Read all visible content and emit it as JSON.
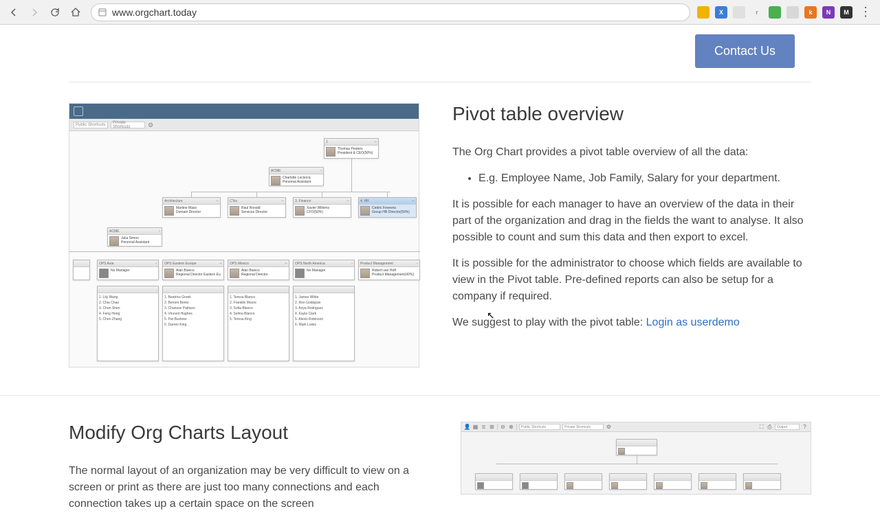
{
  "browser": {
    "url": "www.orgchart.today",
    "extensions": [
      {
        "bg": "#f2b200",
        "txt": ""
      },
      {
        "bg": "#3b7dd8",
        "txt": "X"
      },
      {
        "bg": "#d0d0d0",
        "txt": ""
      },
      {
        "bg": "#d0d0d0",
        "txt": "r"
      },
      {
        "bg": "#4ab050",
        "txt": ""
      },
      {
        "bg": "#d0d0d0",
        "txt": ""
      },
      {
        "bg": "#e87722",
        "txt": "k"
      },
      {
        "bg": "#7d3ab8",
        "txt": "N"
      },
      {
        "bg": "#333333",
        "txt": "M"
      }
    ]
  },
  "header": {
    "contact_label": "Contact Us"
  },
  "section1": {
    "title": "Pivot table overview",
    "p1": "The Org Chart provides a pivot table overview of all the data:",
    "bullet1": "E.g. Employee Name, Job Family, Salary for your department.",
    "p2": "It is possible for each manager to have an overview of the data in their part of the organization and drag in the fields the want to analyse.   It also possible to count and sum this data and then export to excel.",
    "p3": "It is possible for the administrator to choose which fields are available to view in the Pivot table.  Pre-defined reports can also be setup for a company if required.",
    "p4_prefix": "We suggest to play with the pivot table: ",
    "link_text": "Login as userdemo"
  },
  "section2": {
    "title": "Modify Org Charts Layout",
    "p1": "The normal layout of an organization may be very difficult to view on a screen or print as there are just too many connections and each connection takes up a certain space on the screen"
  },
  "mock": {
    "dd1": "Public Shortcuts",
    "dd2": "Private Shortcuts",
    "ceo": {
      "hdr": "1",
      "name": "Thomas Peeters",
      "role": "President & CEO(50%)"
    },
    "assist1": {
      "hdr": "ACME",
      "name": "Charlotte Leclercq",
      "role": "Personal Assistant"
    },
    "row2": [
      {
        "hdr": "Architecture",
        "name": "Martine Mass",
        "role": "Domain Director"
      },
      {
        "hdr": "CTec",
        "name": "Raul Ronald",
        "role": "Services Director"
      },
      {
        "hdr": "3. Finance",
        "name": "Xavier Willems",
        "role": "CFO(50%)"
      },
      {
        "hdr": "4. HR",
        "name": "Cedric Feveens",
        "role": "Group HR Director(50%)"
      }
    ],
    "assist2": {
      "hdr": "ACME",
      "name": "Julia Simon",
      "role": "Personal Assistant"
    },
    "row3": [
      {
        "hdr": "OPS Asia",
        "name": "No Manager"
      },
      {
        "hdr": "OPS Eastern Europe",
        "name": "Alan Bianco",
        "role": "Regional Director Eastern Eu."
      },
      {
        "hdr": "OPS Mexico",
        "name": "Alan Bianco",
        "role": "Regional Director"
      },
      {
        "hdr": "OPS North America",
        "name": "No Manager"
      },
      {
        "hdr": "Product Management",
        "name": "Robert van Hoff",
        "role": "Product Management(42%)"
      }
    ]
  }
}
